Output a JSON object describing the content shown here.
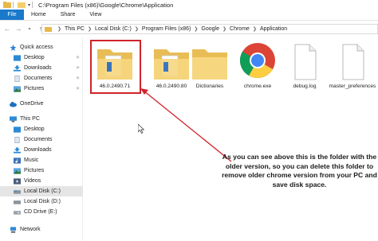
{
  "window": {
    "title": "C:\\Program Files (x86)\\Google\\Chrome\\Application"
  },
  "ribbon": {
    "tabs": [
      "File",
      "Home",
      "Share",
      "View"
    ]
  },
  "address": {
    "crumbs": [
      "This PC",
      "Local Disk (C:)",
      "Program Files (x86)",
      "Google",
      "Chrome",
      "Application"
    ]
  },
  "sidebar": {
    "items": [
      {
        "label": "Quick access",
        "icon": "star-icon"
      },
      {
        "label": "Desktop",
        "icon": "desktop-icon"
      },
      {
        "label": "Downloads",
        "icon": "download-icon"
      },
      {
        "label": "Documents",
        "icon": "documents-icon"
      },
      {
        "label": "Pictures",
        "icon": "pictures-icon"
      },
      {
        "label": "OneDrive",
        "icon": "cloud-icon"
      },
      {
        "label": "This PC",
        "icon": "computer-icon"
      },
      {
        "label": "Desktop",
        "icon": "desktop-icon"
      },
      {
        "label": "Documents",
        "icon": "documents-icon"
      },
      {
        "label": "Downloads",
        "icon": "download-icon"
      },
      {
        "label": "Music",
        "icon": "music-icon"
      },
      {
        "label": "Pictures",
        "icon": "pictures-icon"
      },
      {
        "label": "Videos",
        "icon": "video-icon"
      },
      {
        "label": "Local Disk (C:)",
        "icon": "drive-icon"
      },
      {
        "label": "Local Disk (D:)",
        "icon": "drive-icon"
      },
      {
        "label": "CD Drive (E:)",
        "icon": "cd-drive-icon"
      },
      {
        "label": "Network",
        "icon": "network-icon"
      }
    ],
    "selected": "Local Disk (C:)"
  },
  "files": [
    {
      "name": "46.0.2490.71",
      "type": "folder"
    },
    {
      "name": "46.0.2490.80",
      "type": "folder"
    },
    {
      "name": "Dictionaries",
      "type": "folder"
    },
    {
      "name": "chrome.exe",
      "type": "chrome"
    },
    {
      "name": "debug.log",
      "type": "file"
    },
    {
      "name": "master_preferences",
      "type": "file"
    }
  ],
  "annotation": {
    "text": "As you can see above this is the folder with the older version, so you can delete this folder to remove older chrome version from your PC and save disk space."
  },
  "colors": {
    "accent": "#1979ca",
    "highlight": "#d0232a",
    "folder": "#f5d27a"
  }
}
